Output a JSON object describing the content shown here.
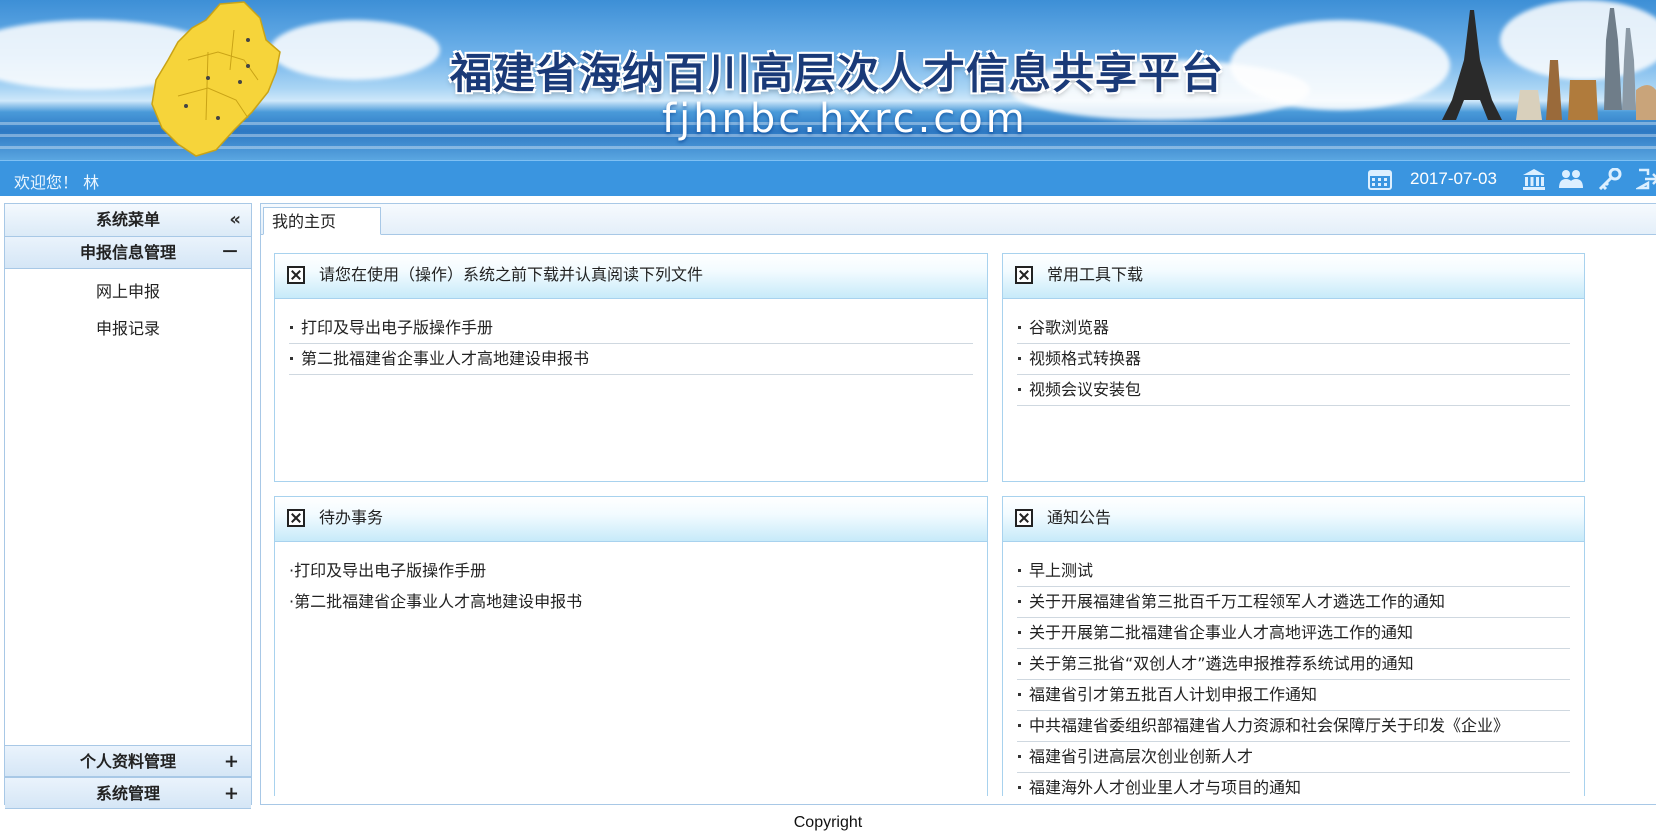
{
  "banner": {
    "title": "福建省海纳百川高层次人才信息共享平台",
    "domain": "fjhnbc.hxrc.com"
  },
  "topbar": {
    "welcome": "欢迎您！ 林",
    "date": "2017-07-03",
    "icons": [
      "calendar-icon",
      "institution-icon",
      "users-icon",
      "key-icon",
      "logout-icon"
    ]
  },
  "sidebar": {
    "title": "系统菜单",
    "collapse_glyph": "«",
    "groups": [
      {
        "label": "申报信息管理",
        "state_glyph": "－",
        "items": [
          "网上申报",
          "申报记录"
        ]
      },
      {
        "label": "个人资料管理",
        "state_glyph": "+"
      },
      {
        "label": "系统管理",
        "state_glyph": "+"
      }
    ]
  },
  "tabs": {
    "active": "我的主页"
  },
  "panels": {
    "docs": {
      "title": "请您在使用（操作）系统之前下载并认真阅读下列文件",
      "items": [
        "打印及导出电子版操作手册",
        "第二批福建省企事业人才高地建设申报书"
      ]
    },
    "tools": {
      "title": "常用工具下载",
      "items": [
        "谷歌浏览器",
        "视频格式转换器",
        "视频会议安装包"
      ]
    },
    "todo": {
      "title": "待办事务",
      "items": [
        "·打印及导出电子版操作手册",
        "·第二批福建省企事业人才高地建设申报书"
      ]
    },
    "notices": {
      "title": "通知公告",
      "items": [
        "早上测试",
        "关于开展福建省第三批百千万工程领军人才遴选工作的通知",
        "关于开展第二批福建省企事业人才高地评选工作的通知",
        "关于第三批省“双创人才”遴选申报推荐系统试用的通知",
        "福建省引才第五批百人计划申报工作通知",
        "中共福建省委组织部福建省人力资源和社会保障厅关于印发《企业》",
        "福建省引进高层次创业创新人才",
        "福建海外人才创业里人才与项目的通知"
      ]
    }
  },
  "footer": {
    "copyright": "Copyright"
  }
}
